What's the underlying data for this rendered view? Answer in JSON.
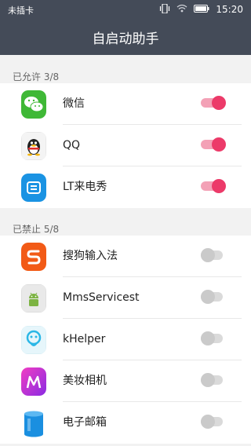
{
  "status_bar": {
    "carrier": "未插卡",
    "time": "15:20"
  },
  "title": "自启动助手",
  "allowed": {
    "header": "已允许 3/8",
    "items": [
      {
        "name": "微信",
        "icon": "wechat-icon",
        "enabled": true
      },
      {
        "name": "QQ",
        "icon": "qq-icon",
        "enabled": true
      },
      {
        "name": "LT来电秀",
        "icon": "lt-caller-show-icon",
        "enabled": true
      }
    ]
  },
  "blocked": {
    "header": "已禁止 5/8",
    "items": [
      {
        "name": "搜狗输入法",
        "icon": "sogou-input-icon",
        "enabled": false
      },
      {
        "name": "MmsServicest",
        "icon": "android-robot-icon",
        "enabled": false
      },
      {
        "name": "kHelper",
        "icon": "khelper-icon",
        "enabled": false
      },
      {
        "name": "美妆相机",
        "icon": "makeup-camera-icon",
        "enabled": false
      },
      {
        "name": "电子邮箱",
        "icon": "email-cylinder-icon",
        "enabled": false
      }
    ]
  },
  "colors": {
    "bar": "#444b58",
    "toggle_on": "#ec3a69",
    "toggle_off": "#cacaca"
  }
}
